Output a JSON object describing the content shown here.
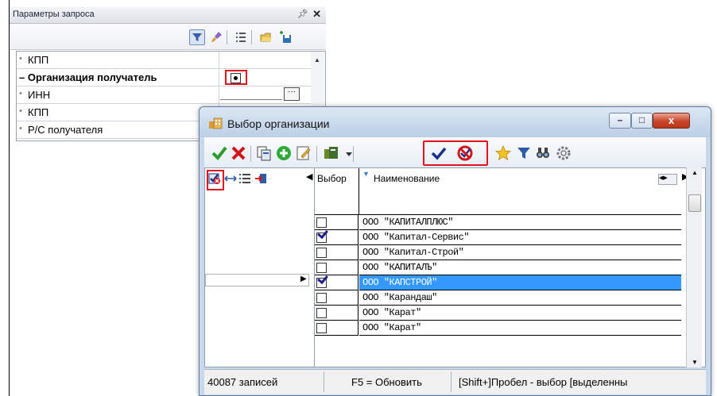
{
  "params_panel": {
    "title": "Параметры запроса",
    "pin_glyph": "ᵖ",
    "close_glyph": "✕",
    "toolbar_icons": [
      "filter-icon",
      "brush-icon",
      "list-icon",
      "open-folder-icon",
      "save-icon"
    ],
    "rows": [
      {
        "label": "КПП",
        "type": "item"
      },
      {
        "label": "Организация получатель",
        "type": "group",
        "prefix": "–"
      },
      {
        "label": "ИНН",
        "type": "item",
        "ellipsis": "···"
      },
      {
        "label": "КПП",
        "type": "item"
      },
      {
        "label": "Р/С получателя",
        "type": "item"
      }
    ]
  },
  "window": {
    "title": "Выбор организации",
    "min_glyph": "–",
    "max_glyph": "□",
    "close_glyph": "x",
    "grid": {
      "columns": [
        "Выбор",
        "Наименование"
      ],
      "rows": [
        {
          "name": "ООО \"КАПИТАЛПЛЮС\"",
          "checked": false,
          "selected": false
        },
        {
          "name": "ООО \"Капитал-Сервис\"",
          "checked": true,
          "selected": false
        },
        {
          "name": "ООО \"Капитал-Строй\"",
          "checked": false,
          "selected": false
        },
        {
          "name": "ООО \"КАПИТАЛЪ\"",
          "checked": false,
          "selected": false
        },
        {
          "name": "ООО \"КАПСТРОЙ\"",
          "checked": true,
          "selected": true
        },
        {
          "name": "ООО \"Карандаш\"",
          "checked": false,
          "selected": false
        },
        {
          "name": "ООО \"Карат\"",
          "checked": false,
          "selected": false
        },
        {
          "name": "ООО \"Карат\"",
          "checked": false,
          "selected": false
        }
      ]
    },
    "status": {
      "count": "40087 записей",
      "refresh": "F5 = Обновить",
      "hint": "[Shift+]Пробел - выбор [выделенны"
    },
    "colors": {
      "selection": "#3399ff",
      "highlight": "#e0141e"
    }
  }
}
